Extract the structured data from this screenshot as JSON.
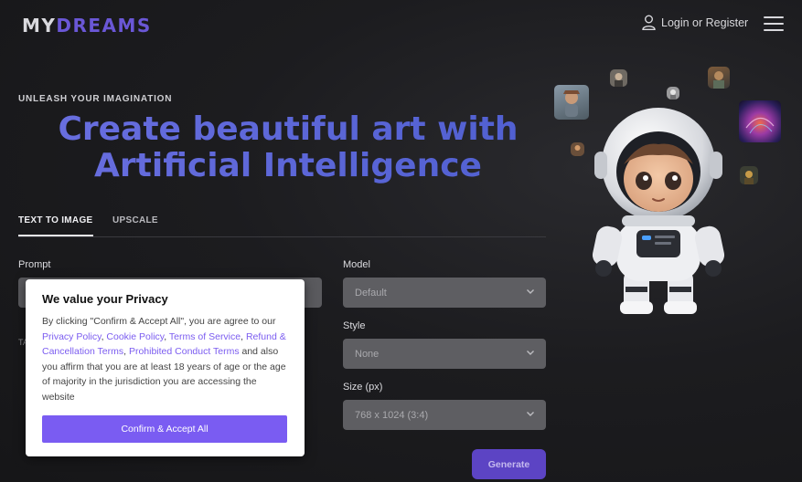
{
  "header": {
    "logo_my": "MY",
    "logo_dreams": "DREAMS",
    "login_label": "Login or Register"
  },
  "hero": {
    "eyebrow": "UNLEASH YOUR IMAGINATION",
    "title_line1": "Create beautiful art with",
    "title_line2": "Artificial Intelligence"
  },
  "tabs": [
    {
      "label": "TEXT TO IMAGE",
      "active": true
    },
    {
      "label": "UPSCALE",
      "active": false
    }
  ],
  "form": {
    "prompt_label": "Prompt",
    "prompt_value": "",
    "partial_label": "TA",
    "model_label": "Model",
    "model_value": "Default",
    "style_label": "Style",
    "style_value": "None",
    "size_label": "Size (px)",
    "size_value": "768 x 1024 (3:4)",
    "generate_label": "Generate"
  },
  "privacy_modal": {
    "title": "We value your Privacy",
    "text_intro": "By clicking \"Confirm & Accept All\", you are agree to our ",
    "link_privacy": "Privacy Policy",
    "sep1": ", ",
    "link_cookie": "Cookie Policy",
    "sep2": ", ",
    "link_terms": "Terms of Service",
    "sep3": ", ",
    "link_refund": "Refund & Cancellation Terms",
    "sep4": ", ",
    "link_prohibited": "Prohibited Conduct Terms",
    "text_outro": " and also you affirm that you are at least 18 years of age or the age of majority in the jurisdiction you are accessing the website",
    "confirm_label": "Confirm & Accept All"
  },
  "colors": {
    "accent": "#7a5cf2",
    "title_blue": "#5865d0",
    "background": "#1c1c1f"
  }
}
